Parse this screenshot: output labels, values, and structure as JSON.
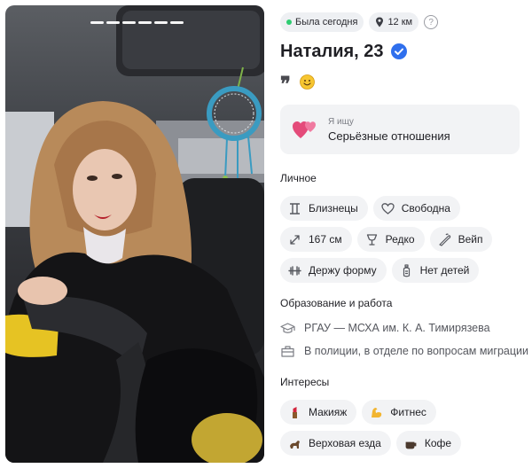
{
  "status": {
    "last_seen": "Была сегодня",
    "distance": "12 км",
    "help_symbol": "?"
  },
  "profile": {
    "name_age": "Наталия, 23",
    "verified_icon": "verified-check-icon",
    "quote_mark": "❞",
    "mood_icon": "smile-emoji-icon"
  },
  "seeking": {
    "icon": "two-hearts-icon",
    "label": "Я ищу",
    "value": "Серьёзные отношения"
  },
  "personal": {
    "title": "Личное",
    "chips": [
      {
        "icon": "zodiac-gemini-icon",
        "label": "Близнецы"
      },
      {
        "icon": "heart-outline-icon",
        "label": "Свободна"
      },
      {
        "icon": "height-arrows-icon",
        "label": "167 см"
      },
      {
        "icon": "wine-glass-icon",
        "label": "Редко"
      },
      {
        "icon": "vape-icon",
        "label": "Вейп"
      },
      {
        "icon": "dumbbell-icon",
        "label": "Держу форму"
      },
      {
        "icon": "baby-bottle-icon",
        "label": "Нет детей"
      }
    ]
  },
  "education_work": {
    "title": "Образование и работа",
    "education": "РГАУ — МСХА им. К. А. Тимирязева",
    "work": "В полиции, в отделе по вопросам миграции"
  },
  "interests": {
    "title": "Интересы",
    "chips": [
      {
        "icon": "lipstick-icon",
        "label": "Макияж"
      },
      {
        "icon": "flexed-biceps-icon",
        "label": "Фитнес"
      },
      {
        "icon": "horse-riding-icon",
        "label": "Верховая езда"
      },
      {
        "icon": "coffee-icon",
        "label": "Кофе"
      }
    ]
  },
  "colors": {
    "online": "#2ecc71",
    "verified": "#2f6fed",
    "chip_bg": "#f2f3f5"
  }
}
